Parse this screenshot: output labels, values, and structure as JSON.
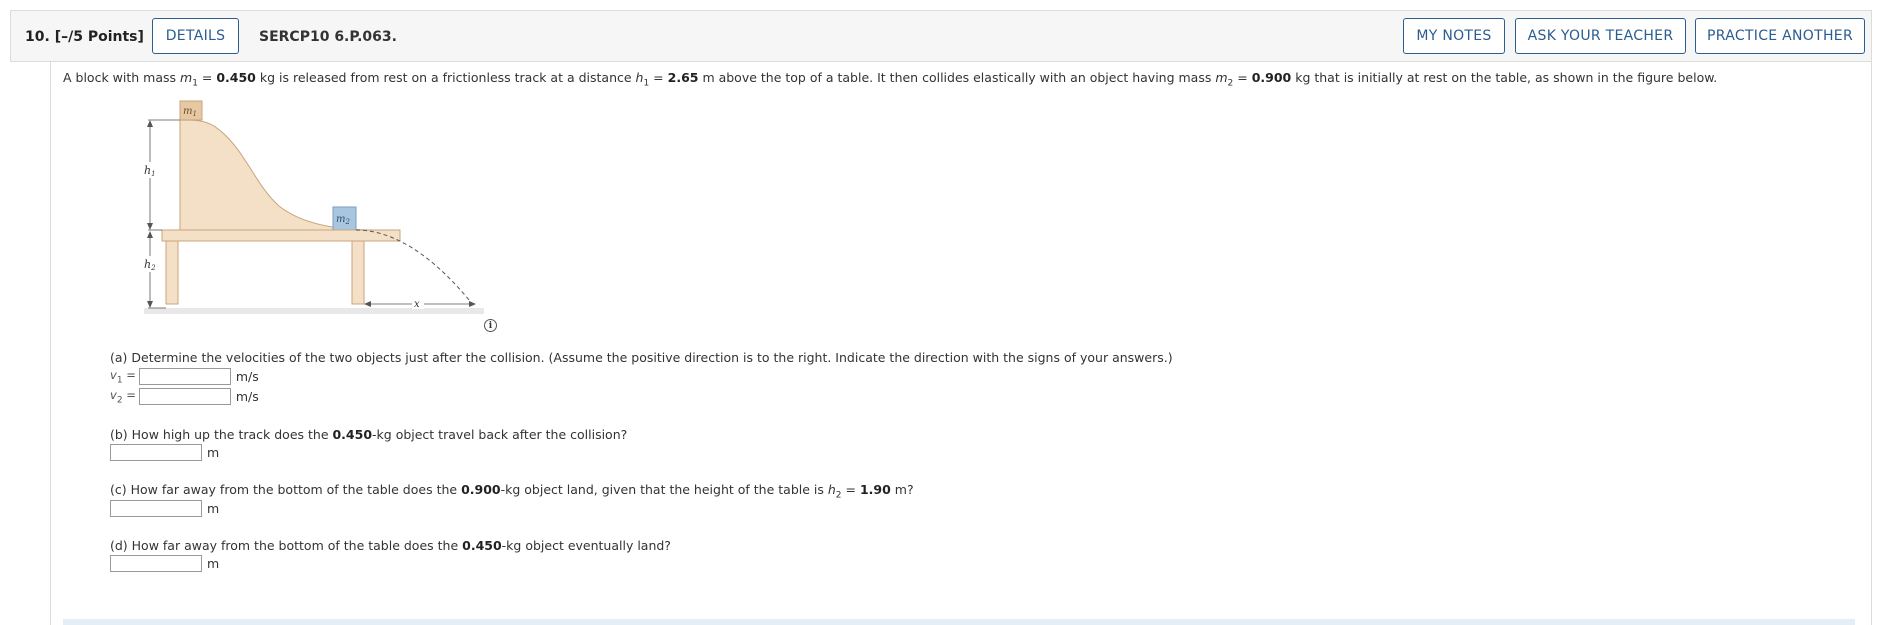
{
  "header": {
    "question_number": "10.",
    "points": "[–/5 Points]",
    "details_label": "DETAILS",
    "code": "SERCP10 6.P.063.",
    "my_notes_label": "MY NOTES",
    "ask_teacher_label": "ASK YOUR TEACHER",
    "practice_label": "PRACTICE ANOTHER"
  },
  "problem": {
    "t1": "A block with mass ",
    "m1_var": "m",
    "m1_sub": "1",
    "t2": " = ",
    "m1_value": "0.450",
    "t3": " kg is released from rest on a frictionless track at a distance ",
    "h1_var": "h",
    "h1_sub": "1",
    "t4": " = ",
    "h1_value": "2.65",
    "t5": " m above the top of a table. It then collides elastically with an object having mass ",
    "m2_var": "m",
    "m2_sub": "2",
    "t6": " = ",
    "m2_value": "0.900",
    "t7": " kg that is initially at rest on the table, as shown in the figure below."
  },
  "figure": {
    "m1": "m",
    "m1_sub": "1",
    "m2": "m",
    "m2_sub": "2",
    "h1": "h",
    "h1_sub": "1",
    "h2": "h",
    "h2_sub": "2",
    "x": "x",
    "info_glyph": "i"
  },
  "parts": {
    "a": {
      "text": "(a) Determine the velocities of the two objects just after the collision. (Assume the positive direction is to the right. Indicate the direction with the signs of your answers.)",
      "v1_var": "v",
      "v1_sub": "1",
      "v2_var": "v",
      "v2_sub": "2",
      "eq": " =",
      "unit": "m/s",
      "v1_value": "",
      "v2_value": ""
    },
    "b": {
      "t1": "(b) How high up the track does the ",
      "mass": "0.450",
      "t2": "-kg object travel back after the collision?",
      "unit": "m",
      "value": ""
    },
    "c": {
      "t1": "(c) How far away from the bottom of the table does the ",
      "mass": "0.900",
      "t2": "-kg object land, given that the height of the table is ",
      "h2_var": "h",
      "h2_sub": "2",
      "t3": " = ",
      "h2_value": "1.90",
      "t4": " m?",
      "unit": "m",
      "value": ""
    },
    "d": {
      "t1": "(d) How far away from the bottom of the table does the ",
      "mass": "0.450",
      "t2": "-kg object eventually land?",
      "unit": "m",
      "value": ""
    }
  },
  "colors": {
    "accent": "#2b5d8e",
    "track_fill": "#f4e0c6",
    "block_m2": "#a9c6e0",
    "block_m1": "#e6c9a2"
  }
}
